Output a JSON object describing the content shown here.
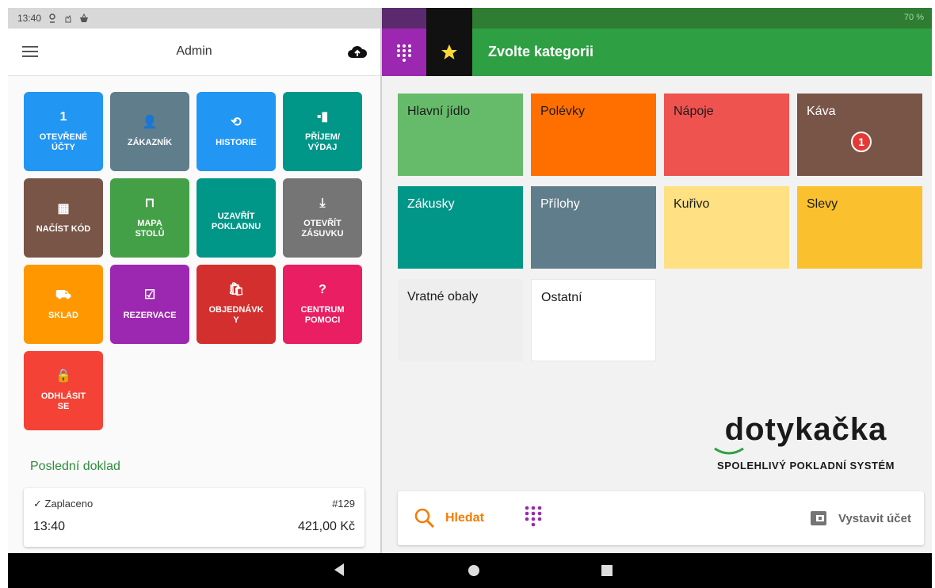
{
  "status": {
    "time": "13:40",
    "battery": "70 %"
  },
  "left": {
    "title": "Admin",
    "tiles": [
      {
        "icon": "1",
        "icon_name": "open-accounts-count",
        "label": "OTEVŘENÉ\nÚČTY",
        "color": "#2196f3"
      },
      {
        "icon": "👤",
        "icon_name": "person-icon",
        "label": "ZÁKAZNÍK",
        "color": "#607d8b"
      },
      {
        "icon": "⟲",
        "icon_name": "history-icon",
        "label": "HISTORIE",
        "color": "#2196f3"
      },
      {
        "icon": "▪▮",
        "icon_name": "cash-icon",
        "label": "PŘÍJEM/\nVÝDAJ",
        "color": "#009688"
      },
      {
        "icon": "▦",
        "icon_name": "qr-code-icon",
        "label": "NAČÍST KÓD",
        "color": "#795548"
      },
      {
        "icon": "⊓",
        "icon_name": "table-icon",
        "label": "MAPA\nSTOLŮ",
        "color": "#43a047"
      },
      {
        "icon": "",
        "icon_name": "close-register-icon",
        "label": "UZAVŘÍT\nPOKLADNU",
        "color": "#009688"
      },
      {
        "icon": "⤓",
        "icon_name": "drawer-icon",
        "label": "OTEVŘÍT\nZÁSUVKU",
        "color": "#757575"
      },
      {
        "icon": "⛟",
        "icon_name": "warehouse-icon",
        "label": "SKLAD",
        "color": "#ff9800"
      },
      {
        "icon": "☑",
        "icon_name": "calendar-icon",
        "label": "REZERVACE",
        "color": "#9c27b0"
      },
      {
        "icon": "🛍",
        "icon_name": "shopping-bag-icon",
        "label": "OBJEDNÁVK\nY",
        "color": "#d32f2f"
      },
      {
        "icon": "?",
        "icon_name": "help-icon",
        "label": "CENTRUM\nPOMOCI",
        "color": "#e91e63"
      },
      {
        "icon": "🔒",
        "icon_name": "lock-icon",
        "label": "ODHLÁSIT\nSE",
        "color": "#f44336"
      }
    ],
    "last_doc_title": "Poslední doklad",
    "receipt": {
      "status": "✓ Zaplaceno",
      "number": "#129",
      "time": "13:40",
      "amount": "421,00 Kč"
    }
  },
  "right": {
    "title": "Zvolte kategorii",
    "categories": [
      {
        "label": "Hlavní jídlo",
        "color": "#66bb6a",
        "text_color": "#1b1b1b"
      },
      {
        "label": "Polévky",
        "color": "#ff6f00",
        "text_color": "#1b1b1b"
      },
      {
        "label": "Nápoje",
        "color": "#ef5350",
        "text_color": "#1b1b1b"
      },
      {
        "label": "Káva",
        "color": "#795548",
        "text_color": "#ffffff",
        "badge": "1"
      },
      {
        "label": "Zákusky",
        "color": "#009688",
        "text_color": "#ffffff"
      },
      {
        "label": "Přílohy",
        "color": "#607d8b",
        "text_color": "#ffffff"
      },
      {
        "label": "Kuřivo",
        "color": "#ffe082",
        "text_color": "#1b1b1b"
      },
      {
        "label": "Slevy",
        "color": "#fbc02d",
        "text_color": "#1b1b1b"
      },
      {
        "label": "Vratné obaly",
        "color": "#eeeeee",
        "text_color": "#1b1b1b"
      },
      {
        "label": "Ostatní",
        "color": "#ffffff",
        "text_color": "#1b1b1b"
      }
    ],
    "logo": {
      "word": "dotykačka",
      "tagline": "SPOLEHLIVÝ POKLADNÍ SYSTÉM"
    },
    "search_label": "Hledat",
    "invoice_label": "Vystavit účet"
  },
  "colors": {
    "accent_green": "#2ea043",
    "search_orange": "#f57c00",
    "purple": "#9c27b0"
  }
}
